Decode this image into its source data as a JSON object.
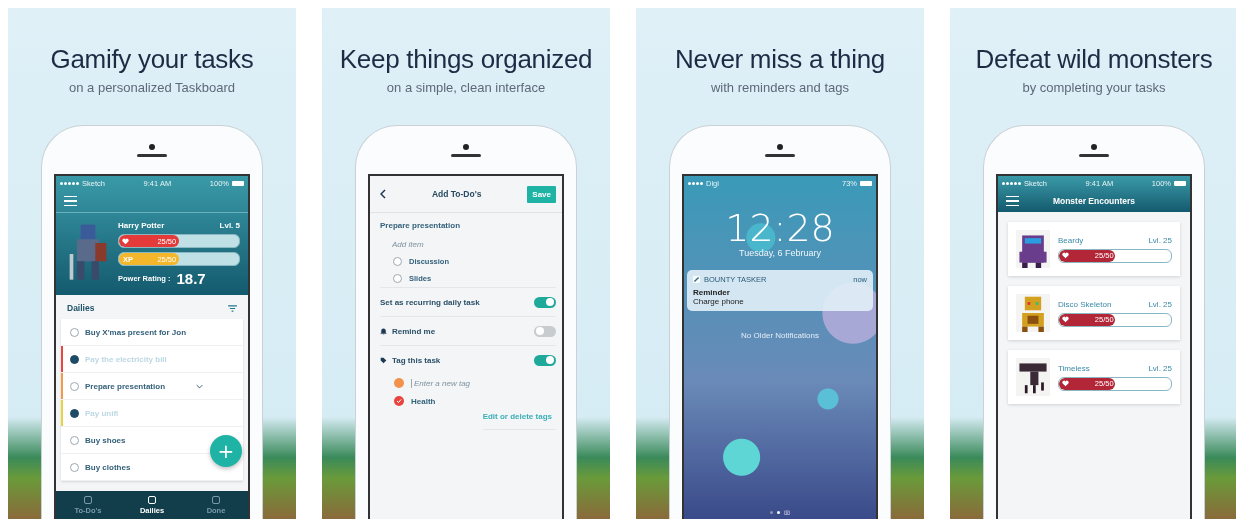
{
  "panels": [
    {
      "kind": "taskboard",
      "title": "Gamify your tasks",
      "subtitle": "on a personalized Taskboard",
      "screen": {
        "status": {
          "carrier": "Sketch",
          "time": "9:41 AM",
          "battery": "100%"
        },
        "hero": {
          "name": "Harry Potter",
          "lvl": "Lvl. 5",
          "health": {
            "reading": "25/50",
            "level": 0.5
          },
          "xp": {
            "label": "XP",
            "reading": "25/50",
            "level": 0.5
          },
          "power_label": "Power Rating :",
          "power_value": "18.7"
        },
        "section": "Dailies",
        "tasks": [
          {
            "label": "Buy X'mas present for Jon",
            "checked": false,
            "collapsible": false
          },
          {
            "label": "Pay the electricity bill",
            "checked": true,
            "color": "#e8483f",
            "collapsible": false
          },
          {
            "label": "Prepare presentation",
            "checked": false,
            "color": "#f39a4a",
            "collapsible": true
          },
          {
            "label": "Pay unifi",
            "checked": true,
            "color": "#e6d442",
            "collapsible": false
          },
          {
            "label": "Buy shoes",
            "checked": false,
            "collapsible": false
          },
          {
            "label": "Buy clothes",
            "checked": false,
            "collapsible": false
          }
        ],
        "fab": "+",
        "tabs": [
          {
            "label": "To-Do's",
            "selected": false
          },
          {
            "label": "Dailies",
            "selected": true
          },
          {
            "label": "Done",
            "selected": false
          }
        ]
      }
    },
    {
      "kind": "editor",
      "title": "Keep things organized",
      "subtitle": "on a simple, clean interface",
      "screen": {
        "nav_title": "Add To-Do's",
        "save": "Save",
        "task": "Prepare presentation",
        "add_placeholder": "Add item",
        "subitems": [
          {
            "label": "Discussion",
            "checked": false
          },
          {
            "label": "Slides",
            "checked": false
          }
        ],
        "settings": [
          {
            "kind": "plain",
            "label": "Set as recurring daily task",
            "on": true
          },
          {
            "kind": "reminder",
            "label": "Remind me",
            "on": false
          },
          {
            "kind": "tags",
            "label": "Tag this task",
            "on": true
          }
        ],
        "tag_field": {
          "placeholder": "Enter a new tag",
          "color": "#f3924a"
        },
        "tags": [
          {
            "label": "Health",
            "checked": true,
            "color": "#e8453f"
          }
        ],
        "tags_link": "Edit or delete tags"
      }
    },
    {
      "kind": "lockscreen",
      "title": "Never miss a thing",
      "subtitle": "with reminders and tags",
      "screen": {
        "carrier": "Digi",
        "battery": "73%",
        "time": "12:28",
        "date": "Tuesday, 6 February",
        "notification": {
          "app": "BOUNTY TASKER",
          "time": "now",
          "title": "Reminder",
          "body": "Charge phone"
        },
        "empty_note": "No Older Notifications",
        "page_dots": [
          {
            "selected": false
          },
          {
            "selected": true
          }
        ]
      }
    },
    {
      "kind": "monsters",
      "title": "Defeat wild monsters",
      "subtitle": "by completing your tasks",
      "screen": {
        "status": {
          "carrier": "Sketch",
          "time": "9:41 AM",
          "battery": "100%"
        },
        "nav_title": "Monster Encounters",
        "monsters": [
          {
            "kind": "blob",
            "name": "Beardy",
            "lvl": "Lvl. 25",
            "reading": "25/50",
            "level": 0.5
          },
          {
            "kind": "skeleton",
            "name": "Disco Skeleton",
            "lvl": "Lvl. 25",
            "reading": "25/50",
            "level": 0.5
          },
          {
            "kind": "beast",
            "name": "Timeless",
            "lvl": "Lvl. 25",
            "reading": "25/50",
            "level": 0.5
          }
        ]
      }
    }
  ]
}
